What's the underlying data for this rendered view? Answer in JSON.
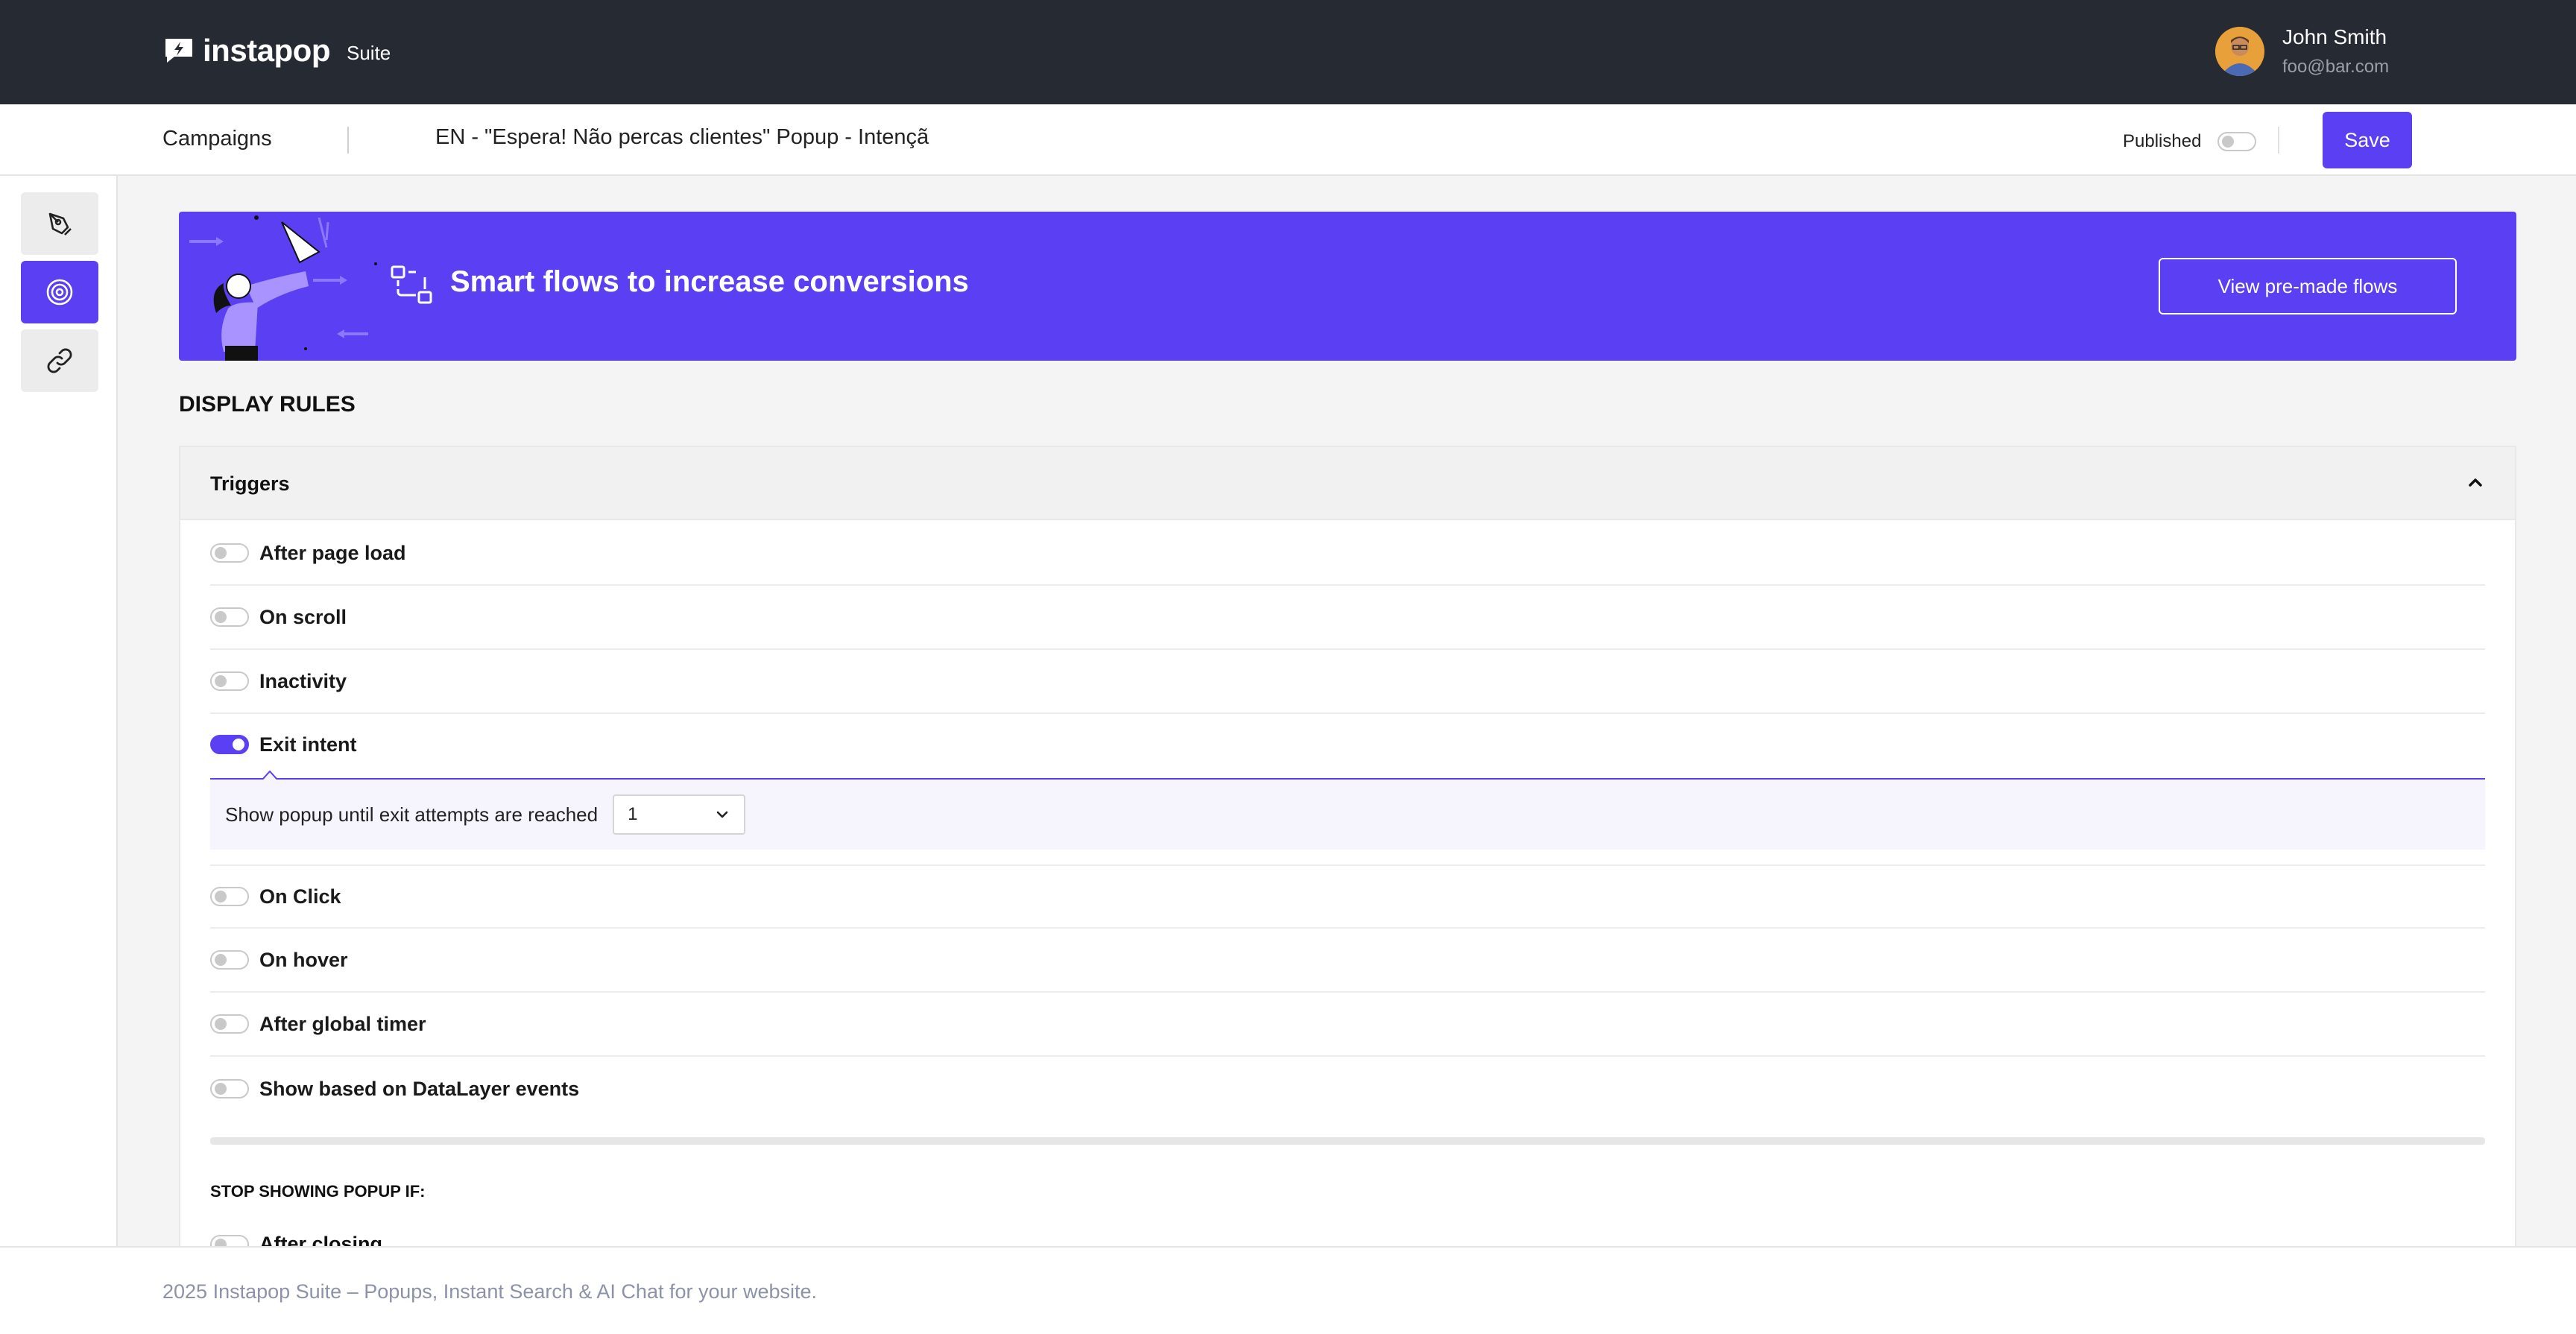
{
  "header": {
    "brand": "instapop",
    "brand_suffix": "Suite",
    "user_name": "John Smith",
    "user_email": "foo@bar.com",
    "bg_color": "#262a33"
  },
  "subbar": {
    "breadcrumb": "Campaigns",
    "campaign_name": "EN - \"Espera! Não percas clientes\" Popup - Intençã",
    "published_label": "Published",
    "published": false,
    "save_label": "Save"
  },
  "sidebar": {
    "items": [
      {
        "icon": "pen-tool-icon",
        "active": false
      },
      {
        "icon": "target-icon",
        "active": true
      },
      {
        "icon": "link-icon",
        "active": false
      }
    ]
  },
  "banner": {
    "title": "Smart flows to increase conversions",
    "button_label": "View pre-made flows",
    "color": "#5b3ff3"
  },
  "display_rules": {
    "title": "DISPLAY RULES",
    "triggers_title": "Triggers",
    "triggers": [
      {
        "label": "After page load",
        "on": false
      },
      {
        "label": "On scroll",
        "on": false
      },
      {
        "label": "Inactivity",
        "on": false
      },
      {
        "label": "Exit intent",
        "on": true
      },
      {
        "label": "On Click",
        "on": false
      },
      {
        "label": "On hover",
        "on": false
      },
      {
        "label": "After global timer",
        "on": false
      },
      {
        "label": "Show based on DataLayer events",
        "on": false
      }
    ],
    "exit_intent": {
      "label": "Show popup until exit attempts are reached",
      "value": "1"
    },
    "stop_title": "STOP SHOWING POPUP IF:",
    "stop_items": [
      {
        "label": "After closing",
        "on": false
      }
    ]
  },
  "footer": {
    "text": "2025 Instapop Suite – Popups, Instant Search & AI Chat for your website."
  },
  "accent_color": "#5b3ff3"
}
